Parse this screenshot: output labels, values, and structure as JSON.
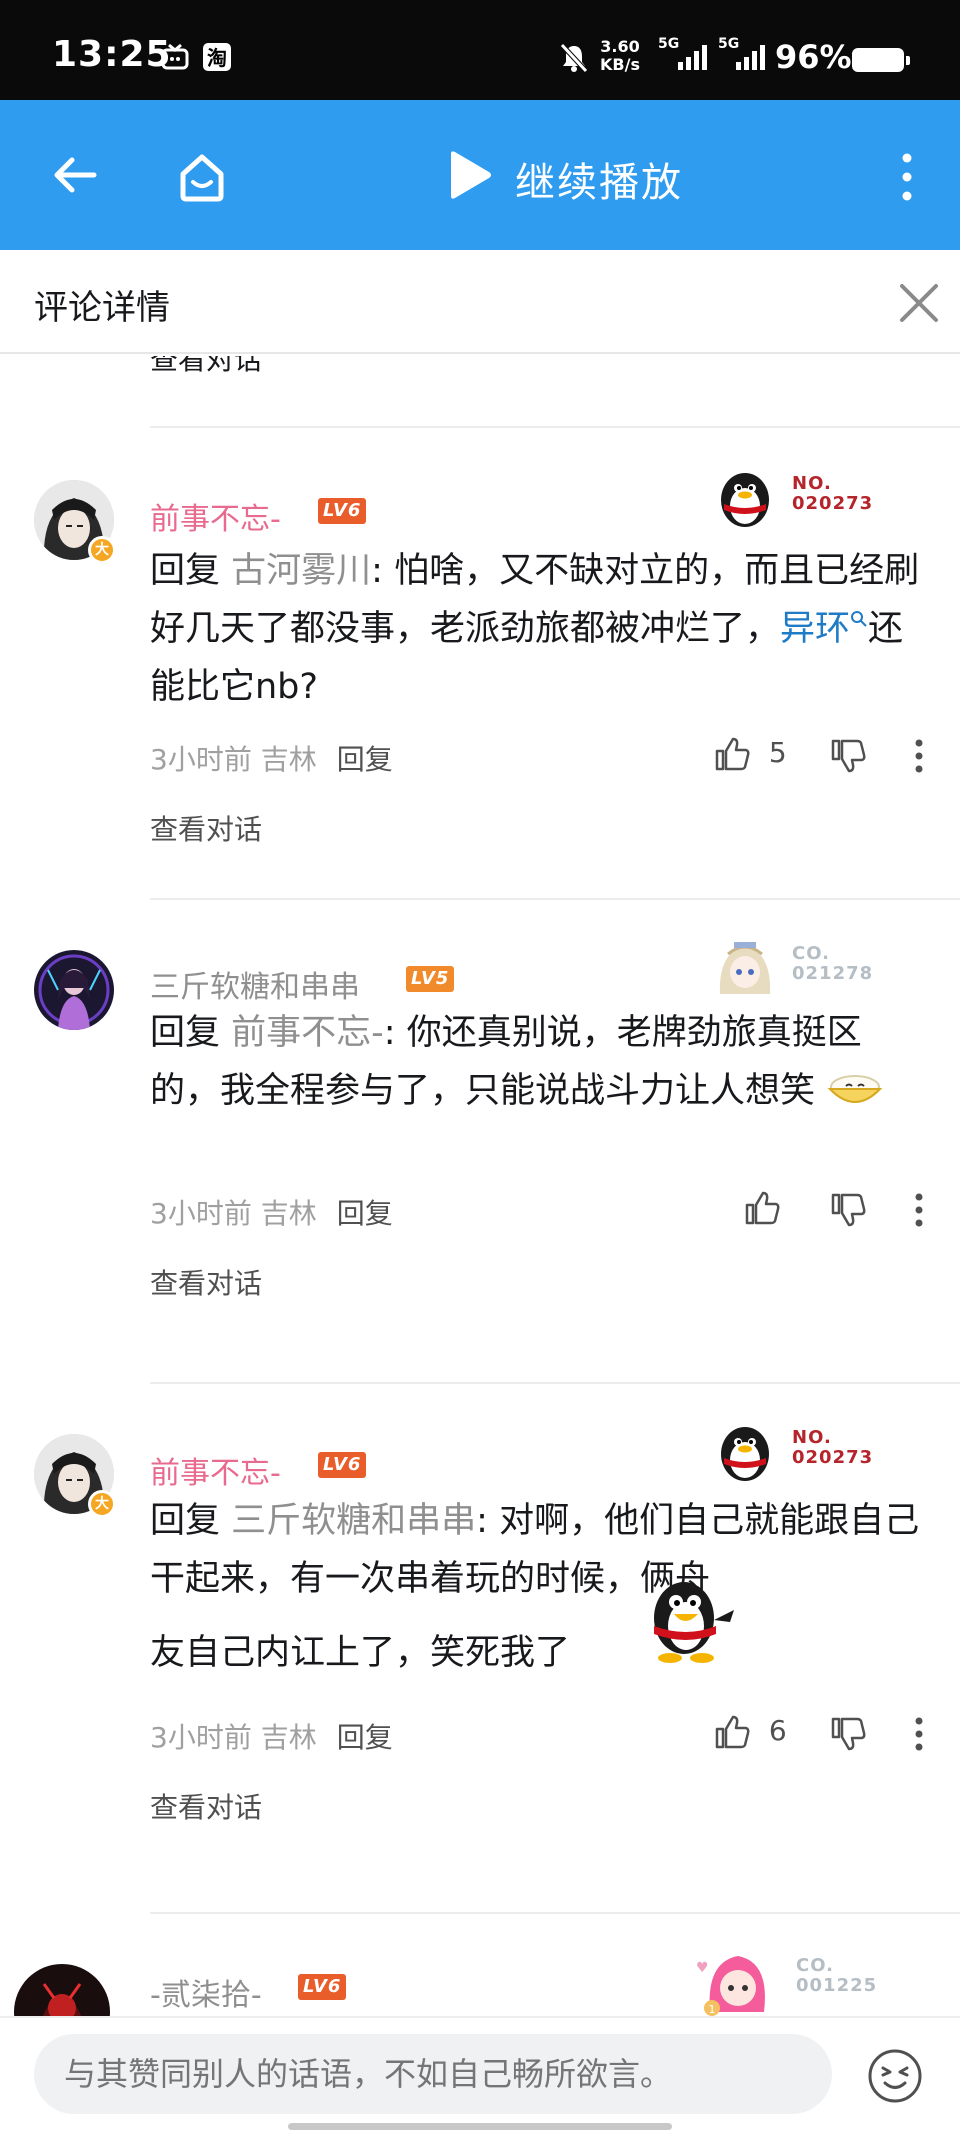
{
  "status_bar": {
    "time": "13:25",
    "net_speed": "3.60",
    "net_unit": "KB/s",
    "signal1_label": "5G",
    "signal2_label": "5G",
    "battery_pct": "96%"
  },
  "app_bar": {
    "play_label": "继续播放"
  },
  "detail_header": {
    "title": "评论详情"
  },
  "partial_view_conv": "查看对话",
  "comments": [
    {
      "username": "前事不忘-",
      "level": "LV6",
      "fan_no": "NO.",
      "fan_id": "020273",
      "reply_prefix": "回复",
      "reply_to": "古河雾川",
      "text_before": ": 怕啥，又不缺对立的，而且已经刷好几天了都没事，老派劲旅都被冲烂了，",
      "tag": "异环",
      "text_after": "还能比它nb?",
      "time": "3小时前",
      "location": "吉林",
      "reply_label": "回复",
      "likes": "5",
      "view_conv": "查看对话"
    },
    {
      "username": "三斤软糖和串串",
      "level": "LV5",
      "fan_no": "CO.",
      "fan_id": "021278",
      "reply_prefix": "回复",
      "reply_to": "前事不忘-",
      "text": ": 你还真别说，老牌劲旅真挺区的，我全程参与了，只能说战斗力让人想笑",
      "time": "3小时前",
      "location": "吉林",
      "reply_label": "回复",
      "likes": "",
      "view_conv": "查看对话"
    },
    {
      "username": "前事不忘-",
      "level": "LV6",
      "fan_no": "NO.",
      "fan_id": "020273",
      "reply_prefix": "回复",
      "reply_to": "三斤软糖和串串",
      "text_line1": ": 对啊，他们自己就能跟自己干起来，有一次串着玩的时候，俩舟",
      "text_line2": "友自己内讧上了，笑死我了",
      "time": "3小时前",
      "location": "吉林",
      "reply_label": "回复",
      "likes": "6",
      "view_conv": "查看对话"
    },
    {
      "username": "-贰柒拾-",
      "level": "LV6",
      "fan_no": "CO.",
      "fan_id": "001225"
    }
  ],
  "input_bar": {
    "placeholder": "与其赞同别人的话语，不如自己畅所欲言。"
  },
  "colors": {
    "app_bar": "#2f9cf0",
    "username_pink": "#e86a8e",
    "tag_link": "#1f7bc6",
    "level_badge": "#e85d2a"
  },
  "icons": [
    "back-icon",
    "home-icon",
    "play-icon",
    "more-icon",
    "close-icon",
    "thumb-up-icon",
    "thumb-down-icon",
    "emoji-icon"
  ]
}
